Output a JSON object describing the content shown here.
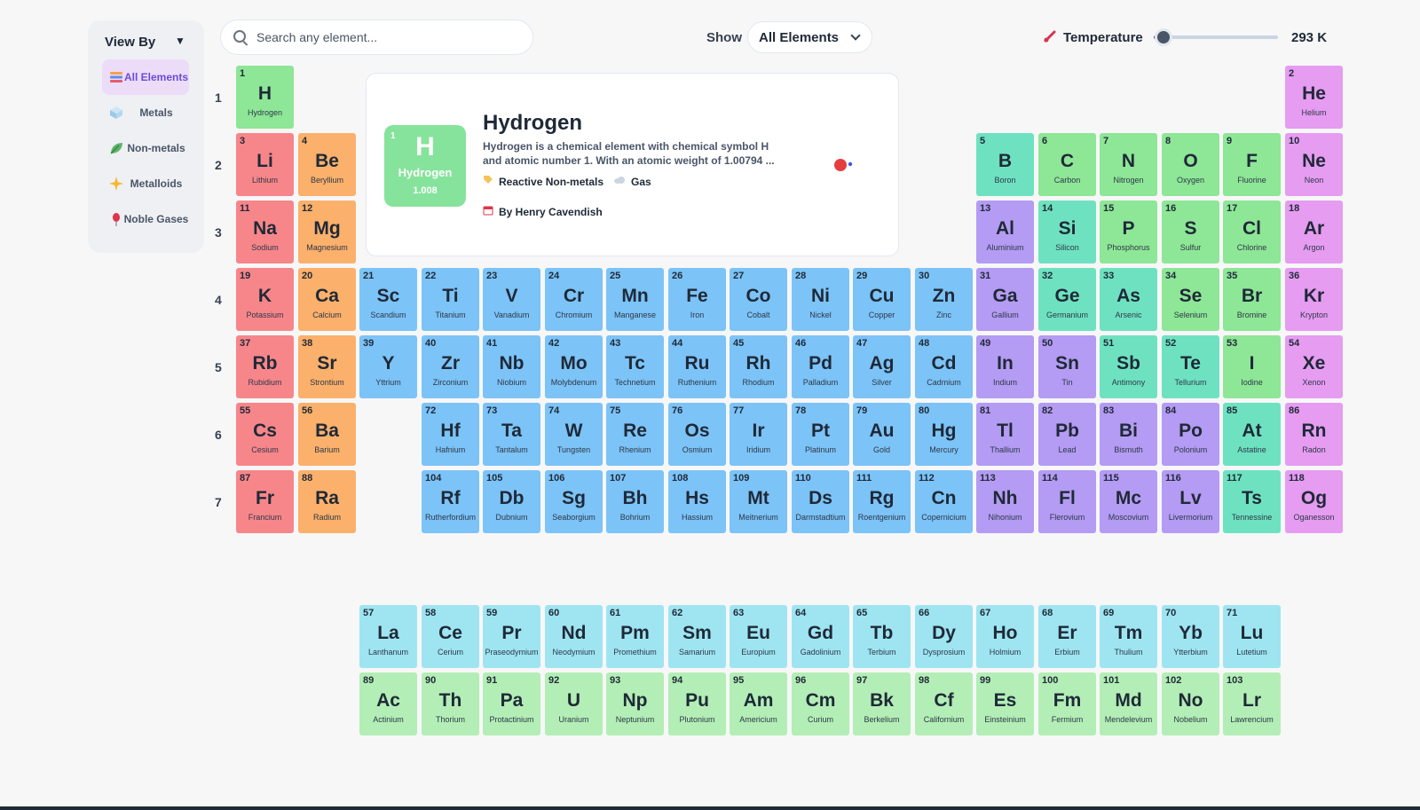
{
  "sidebar": {
    "title": "View By",
    "items": [
      {
        "label": "All Elements",
        "icon": "stack-icon",
        "active": true
      },
      {
        "label": "Metals",
        "icon": "cube-icon",
        "active": false
      },
      {
        "label": "Non-metals",
        "icon": "leaf-icon",
        "active": false
      },
      {
        "label": "Metalloids",
        "icon": "sparkle-icon",
        "active": false
      },
      {
        "label": "Noble Gases",
        "icon": "balloon-icon",
        "active": false
      }
    ]
  },
  "search": {
    "placeholder": "Search any element..."
  },
  "show": {
    "label": "Show",
    "selected": "All Elements"
  },
  "temperature": {
    "label": "Temperature",
    "value": "293 K",
    "level": 0.08
  },
  "rows": [
    "1",
    "2",
    "3",
    "4",
    "5",
    "6",
    "7"
  ],
  "categories": {
    "alkali": "#f7868a",
    "alkaline": "#fbb06b",
    "transition": "#7cc3f7",
    "post": "#b49bf3",
    "metalloid": "#6ee2c0",
    "nonmetal": "#8ee697",
    "noble": "#e59cf1",
    "lanthanide": "#9ee5f1",
    "actinide": "#b3eeb6"
  },
  "selected_element": {
    "number": "1",
    "symbol": "H",
    "name": "Hydrogen",
    "weight": "1.008",
    "description_line1": "Hydrogen is a chemical element with chemical symbol H",
    "description_line2": "and atomic number 1. With an atomic weight of 1.00794 ...",
    "category": "Reactive Non-metals",
    "phase": "Gas",
    "discovered_by": "By Henry Cavendish"
  },
  "elements": [
    {
      "n": "1",
      "s": "H",
      "name": "Hydrogen",
      "c": "nonmetal"
    },
    {
      "n": "2",
      "s": "He",
      "name": "Helium",
      "c": "noble"
    },
    {
      "n": "3",
      "s": "Li",
      "name": "Lithium",
      "c": "alkali"
    },
    {
      "n": "4",
      "s": "Be",
      "name": "Beryllium",
      "c": "alkaline"
    },
    {
      "n": "5",
      "s": "B",
      "name": "Boron",
      "c": "metalloid"
    },
    {
      "n": "6",
      "s": "C",
      "name": "Carbon",
      "c": "nonmetal"
    },
    {
      "n": "7",
      "s": "N",
      "name": "Nitrogen",
      "c": "nonmetal"
    },
    {
      "n": "8",
      "s": "O",
      "name": "Oxygen",
      "c": "nonmetal"
    },
    {
      "n": "9",
      "s": "F",
      "name": "Fluorine",
      "c": "nonmetal"
    },
    {
      "n": "10",
      "s": "Ne",
      "name": "Neon",
      "c": "noble"
    },
    {
      "n": "11",
      "s": "Na",
      "name": "Sodium",
      "c": "alkali"
    },
    {
      "n": "12",
      "s": "Mg",
      "name": "Magnesium",
      "c": "alkaline"
    },
    {
      "n": "13",
      "s": "Al",
      "name": "Aluminium",
      "c": "post"
    },
    {
      "n": "14",
      "s": "Si",
      "name": "Silicon",
      "c": "metalloid"
    },
    {
      "n": "15",
      "s": "P",
      "name": "Phosphorus",
      "c": "nonmetal"
    },
    {
      "n": "16",
      "s": "S",
      "name": "Sulfur",
      "c": "nonmetal"
    },
    {
      "n": "17",
      "s": "Cl",
      "name": "Chlorine",
      "c": "nonmetal"
    },
    {
      "n": "18",
      "s": "Ar",
      "name": "Argon",
      "c": "noble"
    },
    {
      "n": "19",
      "s": "K",
      "name": "Potassium",
      "c": "alkali"
    },
    {
      "n": "20",
      "s": "Ca",
      "name": "Calcium",
      "c": "alkaline"
    },
    {
      "n": "21",
      "s": "Sc",
      "name": "Scandium",
      "c": "transition"
    },
    {
      "n": "22",
      "s": "Ti",
      "name": "Titanium",
      "c": "transition"
    },
    {
      "n": "23",
      "s": "V",
      "name": "Vanadium",
      "c": "transition"
    },
    {
      "n": "24",
      "s": "Cr",
      "name": "Chromium",
      "c": "transition"
    },
    {
      "n": "25",
      "s": "Mn",
      "name": "Manganese",
      "c": "transition"
    },
    {
      "n": "26",
      "s": "Fe",
      "name": "Iron",
      "c": "transition"
    },
    {
      "n": "27",
      "s": "Co",
      "name": "Cobalt",
      "c": "transition"
    },
    {
      "n": "28",
      "s": "Ni",
      "name": "Nickel",
      "c": "transition"
    },
    {
      "n": "29",
      "s": "Cu",
      "name": "Copper",
      "c": "transition"
    },
    {
      "n": "30",
      "s": "Zn",
      "name": "Zinc",
      "c": "transition"
    },
    {
      "n": "31",
      "s": "Ga",
      "name": "Gallium",
      "c": "post"
    },
    {
      "n": "32",
      "s": "Ge",
      "name": "Germanium",
      "c": "metalloid"
    },
    {
      "n": "33",
      "s": "As",
      "name": "Arsenic",
      "c": "metalloid"
    },
    {
      "n": "34",
      "s": "Se",
      "name": "Selenium",
      "c": "nonmetal"
    },
    {
      "n": "35",
      "s": "Br",
      "name": "Bromine",
      "c": "nonmetal"
    },
    {
      "n": "36",
      "s": "Kr",
      "name": "Krypton",
      "c": "noble"
    },
    {
      "n": "37",
      "s": "Rb",
      "name": "Rubidium",
      "c": "alkali"
    },
    {
      "n": "38",
      "s": "Sr",
      "name": "Strontium",
      "c": "alkaline"
    },
    {
      "n": "39",
      "s": "Y",
      "name": "Yttrium",
      "c": "transition"
    },
    {
      "n": "40",
      "s": "Zr",
      "name": "Zirconium",
      "c": "transition"
    },
    {
      "n": "41",
      "s": "Nb",
      "name": "Niobium",
      "c": "transition"
    },
    {
      "n": "42",
      "s": "Mo",
      "name": "Molybdenum",
      "c": "transition"
    },
    {
      "n": "43",
      "s": "Tc",
      "name": "Technetium",
      "c": "transition"
    },
    {
      "n": "44",
      "s": "Ru",
      "name": "Ruthenium",
      "c": "transition"
    },
    {
      "n": "45",
      "s": "Rh",
      "name": "Rhodium",
      "c": "transition"
    },
    {
      "n": "46",
      "s": "Pd",
      "name": "Palladium",
      "c": "transition"
    },
    {
      "n": "47",
      "s": "Ag",
      "name": "Silver",
      "c": "transition"
    },
    {
      "n": "48",
      "s": "Cd",
      "name": "Cadmium",
      "c": "transition"
    },
    {
      "n": "49",
      "s": "In",
      "name": "Indium",
      "c": "post"
    },
    {
      "n": "50",
      "s": "Sn",
      "name": "Tin",
      "c": "post"
    },
    {
      "n": "51",
      "s": "Sb",
      "name": "Antimony",
      "c": "metalloid"
    },
    {
      "n": "52",
      "s": "Te",
      "name": "Tellurium",
      "c": "metalloid"
    },
    {
      "n": "53",
      "s": "I",
      "name": "Iodine",
      "c": "nonmetal"
    },
    {
      "n": "54",
      "s": "Xe",
      "name": "Xenon",
      "c": "noble"
    },
    {
      "n": "55",
      "s": "Cs",
      "name": "Cesium",
      "c": "alkali"
    },
    {
      "n": "56",
      "s": "Ba",
      "name": "Barium",
      "c": "alkaline"
    },
    {
      "n": "72",
      "s": "Hf",
      "name": "Hafnium",
      "c": "transition"
    },
    {
      "n": "73",
      "s": "Ta",
      "name": "Tantalum",
      "c": "transition"
    },
    {
      "n": "74",
      "s": "W",
      "name": "Tungsten",
      "c": "transition"
    },
    {
      "n": "75",
      "s": "Re",
      "name": "Rhenium",
      "c": "transition"
    },
    {
      "n": "76",
      "s": "Os",
      "name": "Osmium",
      "c": "transition"
    },
    {
      "n": "77",
      "s": "Ir",
      "name": "Iridium",
      "c": "transition"
    },
    {
      "n": "78",
      "s": "Pt",
      "name": "Platinum",
      "c": "transition"
    },
    {
      "n": "79",
      "s": "Au",
      "name": "Gold",
      "c": "transition"
    },
    {
      "n": "80",
      "s": "Hg",
      "name": "Mercury",
      "c": "transition"
    },
    {
      "n": "81",
      "s": "Tl",
      "name": "Thallium",
      "c": "post"
    },
    {
      "n": "82",
      "s": "Pb",
      "name": "Lead",
      "c": "post"
    },
    {
      "n": "83",
      "s": "Bi",
      "name": "Bismuth",
      "c": "post"
    },
    {
      "n": "84",
      "s": "Po",
      "name": "Polonium",
      "c": "post"
    },
    {
      "n": "85",
      "s": "At",
      "name": "Astatine",
      "c": "metalloid"
    },
    {
      "n": "86",
      "s": "Rn",
      "name": "Radon",
      "c": "noble"
    },
    {
      "n": "87",
      "s": "Fr",
      "name": "Francium",
      "c": "alkali"
    },
    {
      "n": "88",
      "s": "Ra",
      "name": "Radium",
      "c": "alkaline"
    },
    {
      "n": "104",
      "s": "Rf",
      "name": "Rutherfordium",
      "c": "transition"
    },
    {
      "n": "105",
      "s": "Db",
      "name": "Dubnium",
      "c": "transition"
    },
    {
      "n": "106",
      "s": "Sg",
      "name": "Seaborgium",
      "c": "transition"
    },
    {
      "n": "107",
      "s": "Bh",
      "name": "Bohrium",
      "c": "transition"
    },
    {
      "n": "108",
      "s": "Hs",
      "name": "Hassium",
      "c": "transition"
    },
    {
      "n": "109",
      "s": "Mt",
      "name": "Meitnerium",
      "c": "transition"
    },
    {
      "n": "110",
      "s": "Ds",
      "name": "Darmstadtium",
      "c": "transition"
    },
    {
      "n": "111",
      "s": "Rg",
      "name": "Roentgenium",
      "c": "transition"
    },
    {
      "n": "112",
      "s": "Cn",
      "name": "Copernicium",
      "c": "transition"
    },
    {
      "n": "113",
      "s": "Nh",
      "name": "Nihonium",
      "c": "post"
    },
    {
      "n": "114",
      "s": "Fl",
      "name": "Flerovium",
      "c": "post"
    },
    {
      "n": "115",
      "s": "Mc",
      "name": "Moscovium",
      "c": "post"
    },
    {
      "n": "116",
      "s": "Lv",
      "name": "Livermorium",
      "c": "post"
    },
    {
      "n": "117",
      "s": "Ts",
      "name": "Tennessine",
      "c": "metalloid"
    },
    {
      "n": "118",
      "s": "Og",
      "name": "Oganesson",
      "c": "noble"
    },
    {
      "n": "57",
      "s": "La",
      "name": "Lanthanum",
      "c": "lanthanide"
    },
    {
      "n": "58",
      "s": "Ce",
      "name": "Cerium",
      "c": "lanthanide"
    },
    {
      "n": "59",
      "s": "Pr",
      "name": "Praseodymium",
      "c": "lanthanide"
    },
    {
      "n": "60",
      "s": "Nd",
      "name": "Neodymium",
      "c": "lanthanide"
    },
    {
      "n": "61",
      "s": "Pm",
      "name": "Promethium",
      "c": "lanthanide"
    },
    {
      "n": "62",
      "s": "Sm",
      "name": "Samarium",
      "c": "lanthanide"
    },
    {
      "n": "63",
      "s": "Eu",
      "name": "Europium",
      "c": "lanthanide"
    },
    {
      "n": "64",
      "s": "Gd",
      "name": "Gadolinium",
      "c": "lanthanide"
    },
    {
      "n": "65",
      "s": "Tb",
      "name": "Terbium",
      "c": "lanthanide"
    },
    {
      "n": "66",
      "s": "Dy",
      "name": "Dysprosium",
      "c": "lanthanide"
    },
    {
      "n": "67",
      "s": "Ho",
      "name": "Holmium",
      "c": "lanthanide"
    },
    {
      "n": "68",
      "s": "Er",
      "name": "Erbium",
      "c": "lanthanide"
    },
    {
      "n": "69",
      "s": "Tm",
      "name": "Thulium",
      "c": "lanthanide"
    },
    {
      "n": "70",
      "s": "Yb",
      "name": "Ytterbium",
      "c": "lanthanide"
    },
    {
      "n": "71",
      "s": "Lu",
      "name": "Lutetium",
      "c": "lanthanide"
    },
    {
      "n": "89",
      "s": "Ac",
      "name": "Actinium",
      "c": "actinide"
    },
    {
      "n": "90",
      "s": "Th",
      "name": "Thorium",
      "c": "actinide"
    },
    {
      "n": "91",
      "s": "Pa",
      "name": "Protactinium",
      "c": "actinide"
    },
    {
      "n": "92",
      "s": "U",
      "name": "Uranium",
      "c": "actinide"
    },
    {
      "n": "93",
      "s": "Np",
      "name": "Neptunium",
      "c": "actinide"
    },
    {
      "n": "94",
      "s": "Pu",
      "name": "Plutonium",
      "c": "actinide"
    },
    {
      "n": "95",
      "s": "Am",
      "name": "Americium",
      "c": "actinide"
    },
    {
      "n": "96",
      "s": "Cm",
      "name": "Curium",
      "c": "actinide"
    },
    {
      "n": "97",
      "s": "Bk",
      "name": "Berkelium",
      "c": "actinide"
    },
    {
      "n": "98",
      "s": "Cf",
      "name": "Californium",
      "c": "actinide"
    },
    {
      "n": "99",
      "s": "Es",
      "name": "Einsteinium",
      "c": "actinide"
    },
    {
      "n": "100",
      "s": "Fm",
      "name": "Fermium",
      "c": "actinide"
    },
    {
      "n": "101",
      "s": "Md",
      "name": "Mendelevium",
      "c": "actinide"
    },
    {
      "n": "102",
      "s": "No",
      "name": "Nobelium",
      "c": "actinide"
    },
    {
      "n": "103",
      "s": "Lr",
      "name": "Lawrencium",
      "c": "actinide"
    }
  ]
}
